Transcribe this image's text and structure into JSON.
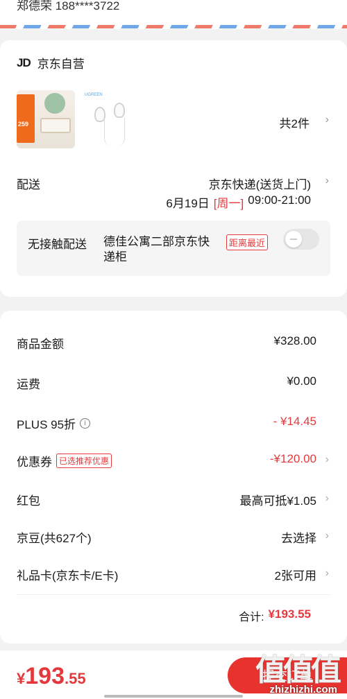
{
  "address": {
    "text": "郑德荣  188****3722"
  },
  "shop": {
    "logo": "JD",
    "name": "京东自营",
    "item_count": "共2件",
    "thumb1_price": "259",
    "thumb2_brand": "UGREEN"
  },
  "delivery": {
    "label": "配送",
    "method": "京东快递(送货上门)",
    "date": "6月19日",
    "weekday": "[周一]",
    "time": "09:00-21:00"
  },
  "no_contact": {
    "label": "无接触配送",
    "place": "德佳公寓二部京东快递柜",
    "badge": "距离最近",
    "enabled": false
  },
  "fees": {
    "goods_label": "商品金额",
    "goods_value": "¥328.00",
    "shipping_label": "运费",
    "shipping_value": "¥0.00",
    "plus_label": "PLUS  95折",
    "plus_value": "- ¥14.45",
    "coupon_label": "优惠券",
    "coupon_badge": "已选推荐优惠",
    "coupon_value": "-¥120.00",
    "redpacket_label": "红包",
    "redpacket_value": "最高可抵¥1.05",
    "jingdou_label": "京豆(共627个)",
    "jingdou_value": "去选择",
    "giftcard_label": "礼品卡(京东卡/E卡)",
    "giftcard_value": "2张可用",
    "total_label": "合计:",
    "total_value": "¥193.55"
  },
  "footer": {
    "yen": "¥",
    "amount_int": "193",
    "amount_dec": ".55",
    "submit_label": "提交订单"
  },
  "watermark": {
    "glyphs": "值值值",
    "site": "zhizhizhi.com"
  },
  "colors": {
    "accent": "#e4393c",
    "button": "#e8322e"
  }
}
